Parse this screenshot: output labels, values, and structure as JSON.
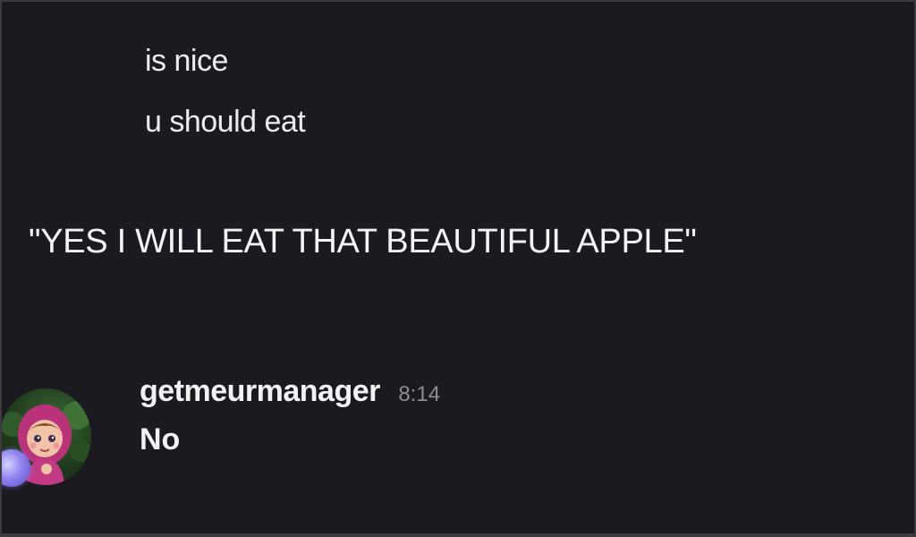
{
  "messages": {
    "prior": [
      {
        "text": "is nice"
      },
      {
        "text": "u should eat"
      }
    ],
    "quote": {
      "text": "\"YES I WILL EAT THAT BEAUTIFUL APPLE\""
    }
  },
  "reply_message": {
    "author": "getmeurmanager",
    "timestamp": "8:14",
    "text": "No",
    "avatar": "girl-in-pink-scarf-avatar"
  },
  "colors": {
    "background": "#1b1a20",
    "text": "#ececef",
    "timestamp": "#8d8e96",
    "status_accent": "#8f83ee"
  }
}
